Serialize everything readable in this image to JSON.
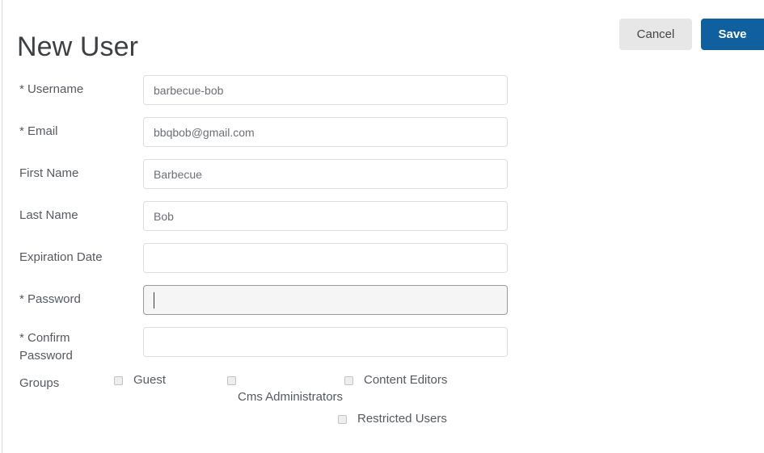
{
  "page": {
    "title": "New User"
  },
  "actions": {
    "cancel_label": "Cancel",
    "save_label": "Save",
    "save_color": "#10609f",
    "cancel_color": "#e7e7e7"
  },
  "form": {
    "required_marker": "*",
    "fields": [
      {
        "label": "Username",
        "required": true,
        "value": "barbecue-bob",
        "placeholder": "",
        "focused": false,
        "type": "text"
      },
      {
        "label": "Email",
        "required": true,
        "value": "bbqbob@gmail.com",
        "placeholder": "",
        "focused": false,
        "type": "text"
      },
      {
        "label": "First Name",
        "required": false,
        "value": "Barbecue",
        "placeholder": "",
        "focused": false,
        "type": "text"
      },
      {
        "label": "Last Name",
        "required": false,
        "value": "Bob",
        "placeholder": "",
        "focused": false,
        "type": "text"
      },
      {
        "label": "Expiration Date",
        "required": false,
        "value": "",
        "placeholder": "",
        "focused": false,
        "type": "text"
      },
      {
        "label": "Password",
        "required": true,
        "value": "",
        "placeholder": "",
        "focused": true,
        "type": "password"
      },
      {
        "label": "Confirm Password",
        "required": true,
        "value": "",
        "placeholder": "",
        "focused": false,
        "type": "password"
      }
    ]
  },
  "groups": {
    "label": "Groups",
    "items": [
      {
        "label": "Guest",
        "checked": false
      },
      {
        "label": "Cms Administrators",
        "checked": false
      },
      {
        "label": "Content Editors",
        "checked": false
      },
      {
        "label": "Restricted Users",
        "checked": false
      }
    ]
  },
  "labels": {
    "username_display": "* Username",
    "email_display": "* Email",
    "first_name_display": "First Name",
    "last_name_display": "Last Name",
    "expiration_display": "Expiration Date",
    "password_display": "* Password",
    "confirm_display": "* Confirm Password"
  }
}
